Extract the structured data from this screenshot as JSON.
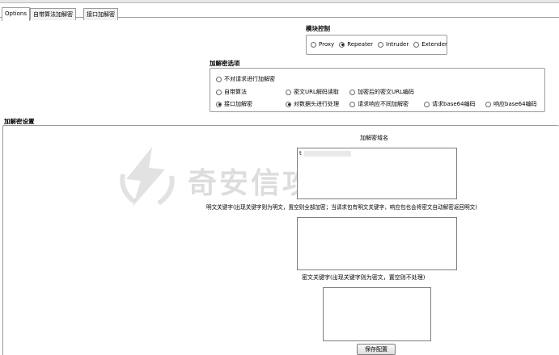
{
  "tabs": [
    {
      "label": "Options",
      "active": true
    },
    {
      "label": "自带算法加解密",
      "active": false
    },
    {
      "label": "接口加解密",
      "active": false
    }
  ],
  "module_control": {
    "title": "模块控制",
    "options": [
      {
        "label": "Proxy",
        "checked": false
      },
      {
        "label": "Repeater",
        "checked": true
      },
      {
        "label": "Intruder",
        "checked": false
      },
      {
        "label": "Extender",
        "checked": false
      }
    ]
  },
  "encdec_options": {
    "title": "加解密选项",
    "row1": [
      {
        "label": "不对请求进行加解密",
        "checked": false
      }
    ],
    "row2": [
      {
        "label": "自带算法",
        "checked": false
      },
      {
        "label": "密文URL解码读取",
        "checked": false
      },
      {
        "label": "加密后的密文URL编码",
        "checked": false
      }
    ],
    "row3": [
      {
        "label": "接口加解密",
        "checked": true
      },
      {
        "label": "对数据头进行处理",
        "checked": true
      },
      {
        "label": "请求响应不同加解密",
        "checked": false
      },
      {
        "label": "请求base64编码",
        "checked": false
      },
      {
        "label": "响应base64编码",
        "checked": false
      }
    ]
  },
  "settings": {
    "title": "加解密设置",
    "domain_label": "加解密域名",
    "domain_value": "t",
    "plain_keyword_label": "明文关键字(出现关键字则为明文，置空则全部加密；当请求包有明文关键字，响应包也会将密文自动解密返回明文)",
    "plain_keyword_value": "",
    "cipher_keyword_label": "密文关键字(出现关键字则为密文，置空则不处理)",
    "cipher_keyword_value": "",
    "save_button": "保存配置"
  },
  "watermark": {
    "text": "奇安信攻防社区"
  },
  "colors": {
    "border": "#9c9c9c",
    "watermark": "#969696"
  }
}
